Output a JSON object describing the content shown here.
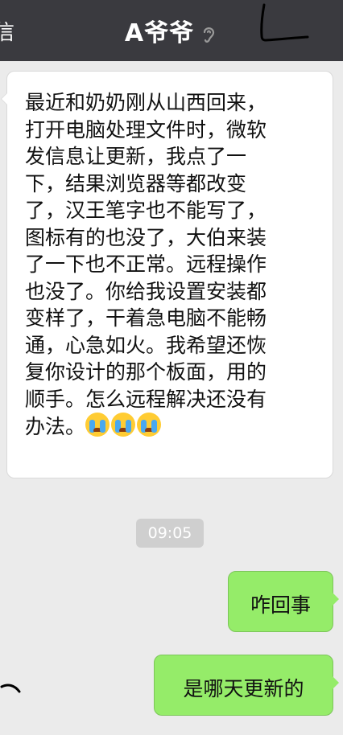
{
  "header": {
    "back_fragment": "信",
    "title": "A爷爷",
    "icons": [
      "ear-icon"
    ]
  },
  "messages": {
    "incoming": {
      "lines": [
        "最近和奶奶刚从山西回来，",
        "打开电脑处理文件时，微软",
        "发信息让更新，我点了一",
        "下，结果浏览器等都改变",
        "了，汉王笔字也不能写了，",
        "图标有的也没了，大伯来装",
        "了一下也不正常。远程操作",
        "也没了。你给我设置安装都",
        "变样了，干着急电脑不能畅",
        "通，心急如火。我希望还恢",
        "复你设计的那个板面，用的",
        "顺手。怎么远程解决还没有",
        "办法。"
      ],
      "emoji": [
        "loudly-crying-face-icon",
        "loudly-crying-face-icon",
        "loudly-crying-face-icon"
      ]
    },
    "timestamp": "09:05",
    "outgoing": [
      {
        "text": "咋回事"
      },
      {
        "text": "是哪天更新的"
      }
    ]
  },
  "colors": {
    "header_bg": "#3a3a3f",
    "chat_bg": "#ebebeb",
    "incoming_bubble": "#ffffff",
    "outgoing_bubble": "#95ec69",
    "timestamp_pill": "#cfcfcf",
    "pen_mark": "#000000"
  }
}
